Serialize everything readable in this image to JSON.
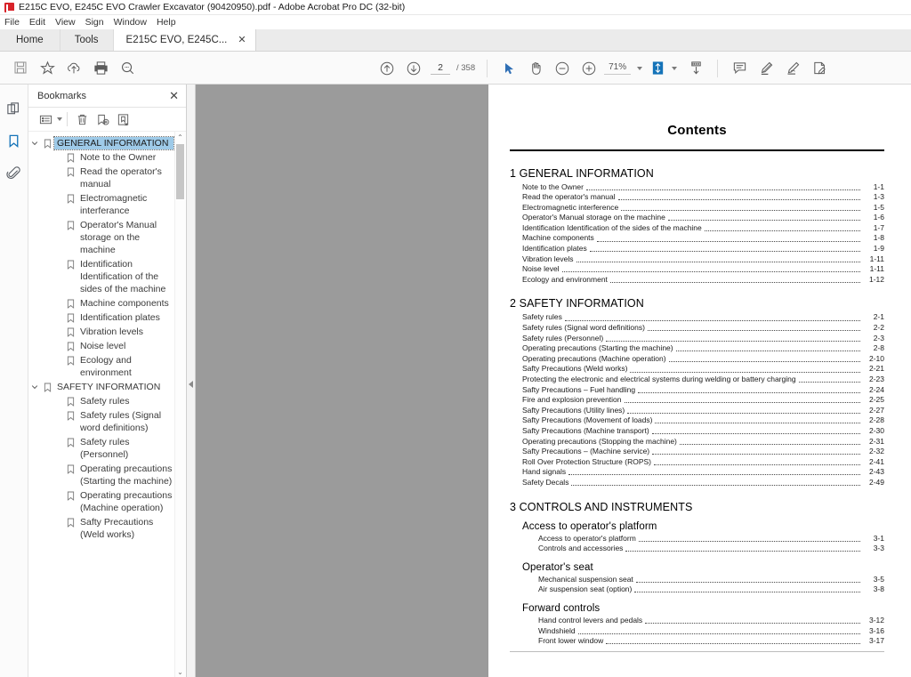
{
  "window": {
    "title": "E215C EVO, E245C EVO Crawler Excavator (90420950).pdf - Adobe Acrobat Pro DC (32-bit)",
    "app_icon": "pdf-logo-icon"
  },
  "menubar": {
    "items": [
      "File",
      "Edit",
      "View",
      "Sign",
      "Window",
      "Help"
    ]
  },
  "tabs": {
    "home_label": "Home",
    "tools_label": "Tools",
    "document_label": "E215C EVO, E245C...",
    "close_glyph": "✕"
  },
  "toolbar": {
    "left_icons": [
      "save-icon",
      "star-icon",
      "cloud-upload-icon",
      "print-icon",
      "search-icon"
    ],
    "page_prev_icon": "page-up-icon",
    "page_next_icon": "page-down-icon",
    "page_current": "2",
    "page_total": "/ 358",
    "select_tool_icon": "select-cursor-icon",
    "hand_tool_icon": "hand-tool-icon",
    "zoom_out_icon": "zoom-out-icon",
    "zoom_in_icon": "zoom-in-icon",
    "zoom_value": "71%",
    "fit_page_icon": "fit-page-icon",
    "scroll_mode_icon": "page-fit-width-icon",
    "comment_icon": "comment-icon",
    "highlight_icon": "highlighter-icon",
    "sign_icon": "sign-pen-icon",
    "stamp_icon": "fill-and-sign-icon"
  },
  "rail": {
    "thumbnails_icon": "page-thumbnails-icon",
    "bookmarks_icon": "bookmarks-icon",
    "attachments_icon": "attachments-paperclip-icon"
  },
  "panel": {
    "title": "Bookmarks",
    "close_glyph": "✕",
    "tools": {
      "options_icon": "list-options-icon",
      "delete_icon": "trash-icon",
      "new_bookmark_icon": "new-bookmark-icon",
      "set_destination_icon": "set-bookmark-destination-icon"
    },
    "scroll_up_glyph": "⌃",
    "scroll_down_glyph": "⌄",
    "bookmarks": [
      {
        "label": "GENERAL INFORMATION",
        "level": 1,
        "expanded": true,
        "selected": true
      },
      {
        "label": "Note to the Owner",
        "level": 2,
        "expanded": false,
        "selected": false
      },
      {
        "label": "Read the operator's manual",
        "level": 2,
        "expanded": false,
        "selected": false
      },
      {
        "label": "Electromagnetic interferance",
        "level": 2,
        "expanded": false,
        "selected": false
      },
      {
        "label": "Operator's Manual storage on the machine",
        "level": 2,
        "expanded": false,
        "selected": false
      },
      {
        "label": "Identification Identification of the sides of the machine",
        "level": 2,
        "expanded": false,
        "selected": false
      },
      {
        "label": "Machine components",
        "level": 2,
        "expanded": false,
        "selected": false
      },
      {
        "label": "Identification plates",
        "level": 2,
        "expanded": false,
        "selected": false
      },
      {
        "label": "Vibration levels",
        "level": 2,
        "expanded": false,
        "selected": false
      },
      {
        "label": "Noise level",
        "level": 2,
        "expanded": false,
        "selected": false
      },
      {
        "label": "Ecology and environment",
        "level": 2,
        "expanded": false,
        "selected": false
      },
      {
        "label": "SAFETY INFORMATION",
        "level": 1,
        "expanded": true,
        "selected": false
      },
      {
        "label": "Safety rules",
        "level": 2,
        "expanded": false,
        "selected": false
      },
      {
        "label": "Safety rules (Signal word definitions)",
        "level": 2,
        "expanded": false,
        "selected": false
      },
      {
        "label": "Safety rules (Personnel)",
        "level": 2,
        "expanded": false,
        "selected": false
      },
      {
        "label": "Operating precautions (Starting the machine)",
        "level": 2,
        "expanded": false,
        "selected": false
      },
      {
        "label": "Operating precautions (Machine operation)",
        "level": 2,
        "expanded": false,
        "selected": false
      },
      {
        "label": "Safty Precautions (Weld works)",
        "level": 2,
        "expanded": false,
        "selected": false
      }
    ]
  },
  "document": {
    "heading": "Contents",
    "chapters": [
      {
        "number": "1",
        "name": "GENERAL INFORMATION",
        "sections": [],
        "entries": [
          {
            "text": "Note to the Owner",
            "page": "1-1"
          },
          {
            "text": "Read the operator's manual",
            "page": "1-3"
          },
          {
            "text": "Electromagnetic interference",
            "page": "1-5"
          },
          {
            "text": "Operator's Manual storage on the machine",
            "page": "1-6"
          },
          {
            "text": "Identification Identification of the sides of the machine",
            "page": "1-7"
          },
          {
            "text": "Machine components",
            "page": "1-8"
          },
          {
            "text": "Identification plates",
            "page": "1-9"
          },
          {
            "text": "Vibration levels",
            "page": "1-11"
          },
          {
            "text": "Noise level",
            "page": "1-11"
          },
          {
            "text": "Ecology and environment",
            "page": "1-12"
          }
        ]
      },
      {
        "number": "2",
        "name": "SAFETY INFORMATION",
        "sections": [],
        "entries": [
          {
            "text": "Safety rules",
            "page": "2-1"
          },
          {
            "text": "Safety rules (Signal word definitions)",
            "page": "2-2"
          },
          {
            "text": "Safety rules (Personnel)",
            "page": "2-3"
          },
          {
            "text": "Operating precautions (Starting the machine)",
            "page": "2-8"
          },
          {
            "text": "Operating precautions (Machine operation)",
            "page": "2-10"
          },
          {
            "text": "Safty Precautions (Weld works)",
            "page": "2-21"
          },
          {
            "text": "Protecting the electronic and electrical systems during welding or battery charging",
            "page": "2-23"
          },
          {
            "text": "Safty Precautions – Fuel handling",
            "page": "2-24"
          },
          {
            "text": "Fire and explosion prevention",
            "page": "2-25"
          },
          {
            "text": "Safty Precautions (Utility lines)",
            "page": "2-27"
          },
          {
            "text": "Safty Precautions (Movement of loads)",
            "page": "2-28"
          },
          {
            "text": "Safty Precautions (Machine transport)",
            "page": "2-30"
          },
          {
            "text": "Operating precautions (Stopping the machine)",
            "page": "2-31"
          },
          {
            "text": "Safty Precautions – (Machine service)",
            "page": "2-32"
          },
          {
            "text": "Roll Over Protection Structure (ROPS)",
            "page": "2-41"
          },
          {
            "text": "Hand signals",
            "page": "2-43"
          },
          {
            "text": "Safety Decals",
            "page": "2-49"
          }
        ]
      },
      {
        "number": "3",
        "name": "CONTROLS AND INSTRUMENTS",
        "entries": [],
        "sections": [
          {
            "heading": "Access to operator's platform",
            "entries": [
              {
                "text": "Access to operator's platform",
                "page": "3-1"
              },
              {
                "text": "Controls and accessories",
                "page": "3-3"
              }
            ]
          },
          {
            "heading": "Operator's seat",
            "entries": [
              {
                "text": "Mechanical suspension seat",
                "page": "3-5"
              },
              {
                "text": "Air suspension seat (option)",
                "page": "3-8"
              }
            ]
          },
          {
            "heading": "Forward controls",
            "entries": [
              {
                "text": "Hand control levers and pedals",
                "page": "3-12"
              },
              {
                "text": "Windshield",
                "page": "3-16"
              },
              {
                "text": "Front lower window",
                "page": "3-17"
              }
            ]
          }
        ]
      }
    ]
  },
  "colors": {
    "accent_blue": "#1473b8",
    "selection_blue": "#9ecae8",
    "doc_background": "#9b9b9b",
    "pdf_red": "#d8232a"
  }
}
